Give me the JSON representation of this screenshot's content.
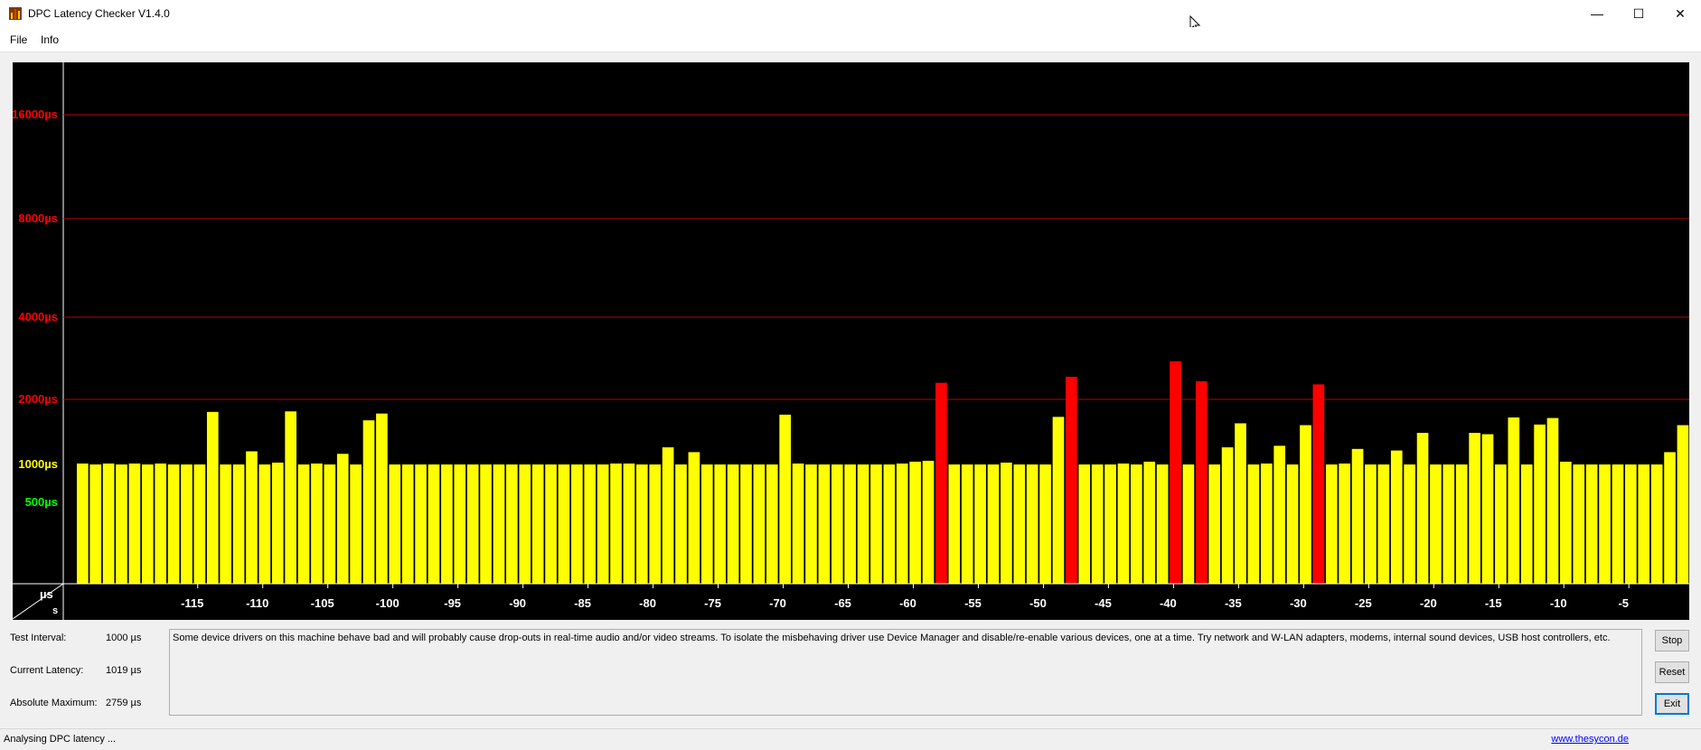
{
  "window": {
    "title": "DPC Latency Checker V1.4.0",
    "minimize": "—",
    "maximize": "☐",
    "close": "✕"
  },
  "menu": {
    "items": [
      "File",
      "Info"
    ]
  },
  "chart_data": {
    "type": "bar",
    "title": "",
    "y_unit_label": "µs",
    "x_unit_label": "s",
    "y_ticks": [
      {
        "label": "16000µs",
        "value": 16000,
        "color": "#ff0000"
      },
      {
        "label": "8000µs",
        "value": 8000,
        "color": "#ff0000"
      },
      {
        "label": "4000µs",
        "value": 4000,
        "color": "#ff0000"
      },
      {
        "label": "2000µs",
        "value": 2000,
        "color": "#ff0000"
      },
      {
        "label": "1000µs",
        "value": 1000,
        "color": "#ffff00"
      },
      {
        "label": "500µs",
        "value": 500,
        "color": "#00ff00"
      }
    ],
    "x_ticks": [
      "-115",
      "-110",
      "-105",
      "-100",
      "-95",
      "-90",
      "-85",
      "-80",
      "-75",
      "-70",
      "-65",
      "-60",
      "-55",
      "-50",
      "-45",
      "-40",
      "-35",
      "-30",
      "-25",
      "-20",
      "-15",
      "-10",
      "-5"
    ],
    "threshold_red": 2000,
    "bar_color_ok": "#ffff00",
    "bar_color_bad": "#ff0000",
    "values": [
      1010,
      1000,
      1010,
      1000,
      1010,
      1000,
      1010,
      1000,
      1000,
      1000,
      1750,
      1000,
      1000,
      1150,
      1000,
      1020,
      1760,
      1000,
      1010,
      1000,
      1120,
      1000,
      1600,
      1720,
      1000,
      1000,
      1000,
      1000,
      1000,
      1000,
      1000,
      1000,
      1000,
      1000,
      1000,
      1000,
      1000,
      1000,
      1000,
      1000,
      1000,
      1010,
      1010,
      1000,
      1000,
      1200,
      1000,
      1140,
      1000,
      1000,
      1000,
      1000,
      1000,
      1000,
      1700,
      1010,
      1000,
      1000,
      1000,
      1000,
      1000,
      1000,
      1000,
      1010,
      1030,
      1040,
      2300,
      1000,
      1000,
      1000,
      1000,
      1020,
      1000,
      1000,
      1000,
      1660,
      2420,
      1000,
      1000,
      1000,
      1010,
      1000,
      1030,
      1000,
      2759,
      1000,
      2330,
      1000,
      1200,
      1550,
      1000,
      1010,
      1220,
      1000,
      1520,
      2270,
      1000,
      1010,
      1180,
      1000,
      1000,
      1160,
      1000,
      1400,
      1000,
      1000,
      1000,
      1400,
      1380,
      1000,
      1650,
      1000,
      1530,
      1640,
      1030,
      1000,
      1000,
      1000,
      1000,
      1000,
      1000,
      1000,
      1140,
      1520
    ]
  },
  "status": {
    "test_interval_label": "Test Interval:",
    "test_interval_value": "1000 µs",
    "current_latency_label": "Current Latency:",
    "current_latency_value": "1019 µs",
    "absolute_max_label": "Absolute Maximum:",
    "absolute_max_value": "2759 µs",
    "message": "Some device drivers on this machine behave bad and will probably cause drop-outs in real-time audio and/or video streams. To isolate the misbehaving driver use Device Manager and disable/re-enable various devices, one at a time. Try network and W-LAN adapters, modems, internal sound devices, USB host controllers, etc."
  },
  "buttons": {
    "stop": "Stop",
    "reset": "Reset",
    "exit": "Exit"
  },
  "statusbar": {
    "text": "Analysing DPC latency ...",
    "link": "www.thesycon.de"
  }
}
